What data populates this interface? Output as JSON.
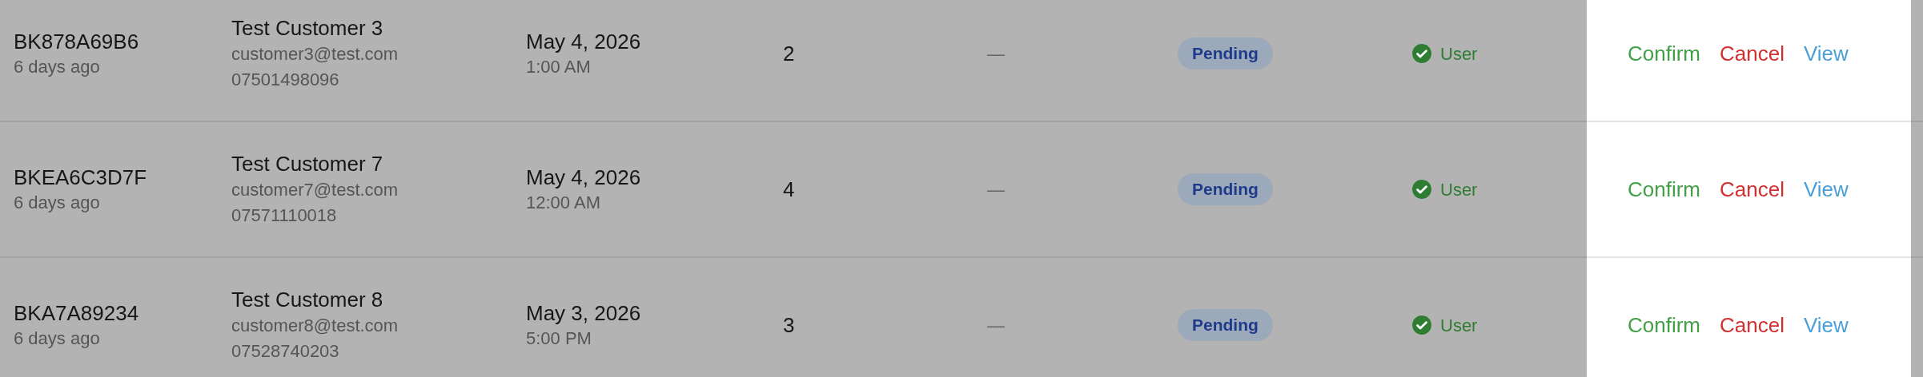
{
  "rows": [
    {
      "booking_id": "BK878A69B6",
      "age": "6 days ago",
      "customer": {
        "name": "Test Customer 3",
        "email": "customer3@test.com",
        "phone": "07501498096"
      },
      "date": "May 4, 2026",
      "time": "1:00 AM",
      "count": "2",
      "column_5": "—",
      "status": "Pending",
      "source": "User",
      "actions": [
        {
          "kind": "confirm",
          "label": "Confirm"
        },
        {
          "kind": "cancel",
          "label": "Cancel"
        },
        {
          "kind": "view",
          "label": "View"
        }
      ]
    },
    {
      "booking_id": "BKEA6C3D7F",
      "age": "6 days ago",
      "customer": {
        "name": "Test Customer 7",
        "email": "customer7@test.com",
        "phone": "07571110018"
      },
      "date": "May 4, 2026",
      "time": "12:00 AM",
      "count": "4",
      "column_5": "—",
      "status": "Pending",
      "source": "User",
      "actions": [
        {
          "kind": "confirm",
          "label": "Confirm"
        },
        {
          "kind": "cancel",
          "label": "Cancel"
        },
        {
          "kind": "view",
          "label": "View"
        }
      ]
    },
    {
      "booking_id": "BKA7A89234",
      "age": "6 days ago",
      "customer": {
        "name": "Test Customer 8",
        "email": "customer8@test.com",
        "phone": "07528740203"
      },
      "date": "May 3, 2026",
      "time": "5:00 PM",
      "count": "3",
      "column_5": "—",
      "status": "Pending",
      "source": "User",
      "actions": [
        {
          "kind": "confirm",
          "label": "Confirm"
        },
        {
          "kind": "cancel",
          "label": "Cancel"
        },
        {
          "kind": "view",
          "label": "View"
        }
      ]
    }
  ]
}
